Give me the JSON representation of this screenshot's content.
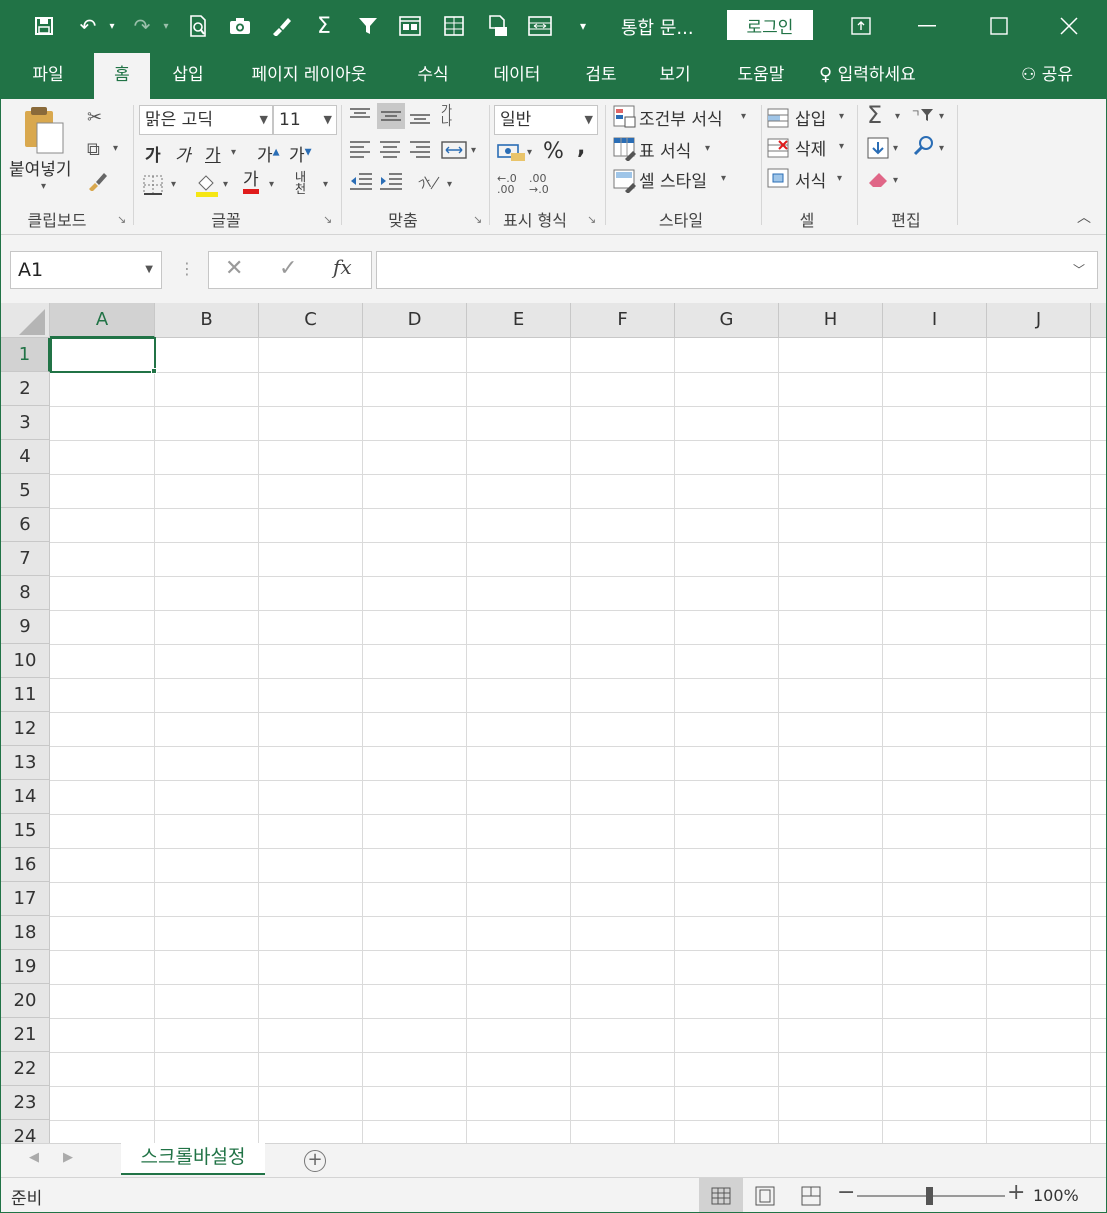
{
  "title": {
    "doc": "통합 문...",
    "login": "로그인"
  },
  "tabs": [
    {
      "label": "파일"
    },
    {
      "label": "홈"
    },
    {
      "label": "삽입"
    },
    {
      "label": "페이지 레이아웃"
    },
    {
      "label": "수식"
    },
    {
      "label": "데이터"
    },
    {
      "label": "검토"
    },
    {
      "label": "보기"
    },
    {
      "label": "도움말"
    }
  ],
  "tell_me": "입력하세요",
  "share": "공유",
  "ribbon": {
    "clipboard": {
      "paste": "붙여넣기",
      "label": "클립보드"
    },
    "font": {
      "name": "맑은 고딕",
      "size": "11",
      "bold": "가",
      "italic": "가",
      "underline": "가",
      "grow": "가",
      "shrink": "가",
      "color_glyph": "가",
      "phonetic": "내천",
      "label": "글꼴"
    },
    "alignment": {
      "label": "맞춤"
    },
    "number": {
      "format": "일반",
      "percent": "%",
      "comma": ",",
      "inc": ".0\n.00",
      "dec": ".00\n.0",
      "label": "표시 형식"
    },
    "styles": {
      "conditional": "조건부 서식",
      "table": "표 서식",
      "cell": "셀 스타일",
      "label": "스타일"
    },
    "cells": {
      "insert": "삽입",
      "delete": "삭제",
      "format": "서식",
      "label": "셀"
    },
    "editing": {
      "label": "편집"
    }
  },
  "formula_bar": {
    "name_box": "A1",
    "value": ""
  },
  "columns": [
    "A",
    "B",
    "C",
    "D",
    "E",
    "F",
    "G",
    "H",
    "I",
    "J"
  ],
  "rows": [
    "1",
    "2",
    "3",
    "4",
    "5",
    "6",
    "7",
    "8",
    "9",
    "10",
    "11",
    "12",
    "13",
    "14",
    "15",
    "16",
    "17",
    "18",
    "19",
    "20",
    "21",
    "22",
    "23",
    "24"
  ],
  "sheet_tab": "스크롤바설정",
  "status": {
    "ready": "준비",
    "zoom": "100%"
  },
  "colors": {
    "accent": "#217346"
  }
}
